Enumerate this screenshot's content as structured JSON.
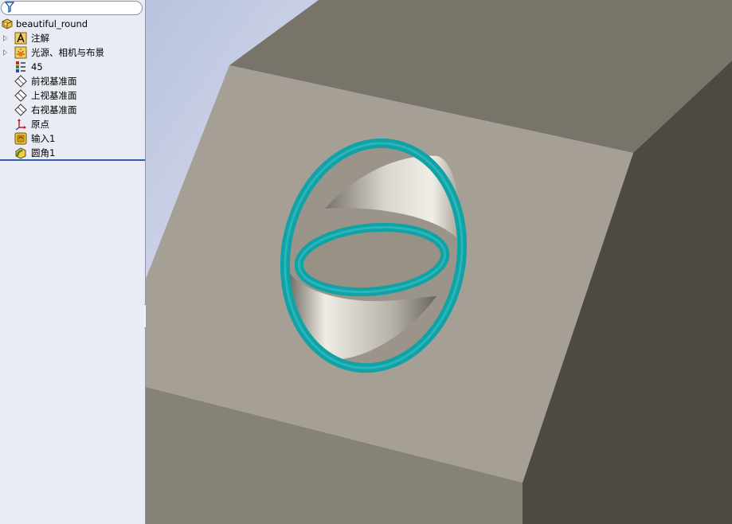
{
  "feature_tree": {
    "filter_placeholder": "",
    "items": [
      {
        "label": "beautiful_round",
        "icon": "part-icon",
        "level": 0
      },
      {
        "label": "注解",
        "icon": "annotations-icon",
        "level": 1,
        "expandable": true
      },
      {
        "label": "光源、相机与布景",
        "icon": "lights-cameras-scene-icon",
        "level": 1,
        "expandable": true
      },
      {
        "label": "45",
        "icon": "material-icon",
        "level": 1
      },
      {
        "label": "前视基准面",
        "icon": "plane-icon",
        "level": 1
      },
      {
        "label": "上视基准面",
        "icon": "plane-icon",
        "level": 1
      },
      {
        "label": "右视基准面",
        "icon": "plane-icon",
        "level": 1
      },
      {
        "label": "原点",
        "icon": "origin-icon",
        "level": 1
      },
      {
        "label": "输入1",
        "icon": "imported-body-icon",
        "level": 1
      },
      {
        "label": "圆角1",
        "icon": "fillet-icon",
        "level": 1
      }
    ]
  },
  "viewport": {
    "model": "block-with-filleted-hole",
    "colors": {
      "top_face": "#79746a",
      "front_face": "#a59f95",
      "right_face": "#4d4a44",
      "bottom_face": "#878276",
      "fillet_highlight": "#11a2a6"
    }
  }
}
